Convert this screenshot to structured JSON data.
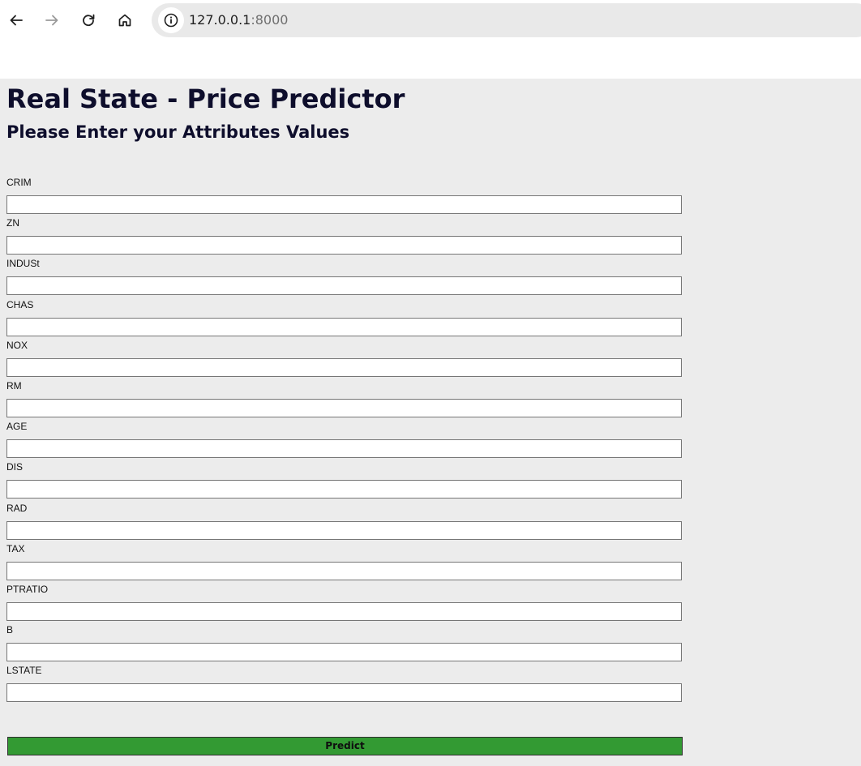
{
  "browser": {
    "back_icon": "arrow-left-icon",
    "forward_icon": "arrow-right-icon",
    "reload_icon": "reload-icon",
    "home_icon": "home-icon",
    "info_icon": "info-icon",
    "url_host": "127.0.0.1",
    "url_port": ":8000"
  },
  "page": {
    "title": "Real State - Price Predictor",
    "subtitle": "Please Enter your Attributes Values",
    "background": "#ececec",
    "title_color": "#0e0e2c"
  },
  "form": {
    "fields": [
      {
        "label": "CRIM",
        "value": ""
      },
      {
        "label": "ZN",
        "value": ""
      },
      {
        "label": "INDUSt",
        "value": ""
      },
      {
        "label": "CHAS",
        "value": ""
      },
      {
        "label": "NOX",
        "value": ""
      },
      {
        "label": "RM",
        "value": ""
      },
      {
        "label": "AGE",
        "value": ""
      },
      {
        "label": "DIS",
        "value": ""
      },
      {
        "label": "RAD",
        "value": ""
      },
      {
        "label": "TAX",
        "value": ""
      },
      {
        "label": "PTRATIO",
        "value": ""
      },
      {
        "label": "B",
        "value": ""
      },
      {
        "label": "LSTATE",
        "value": ""
      }
    ],
    "submit_label": "Predict",
    "submit_color": "#339a33"
  }
}
